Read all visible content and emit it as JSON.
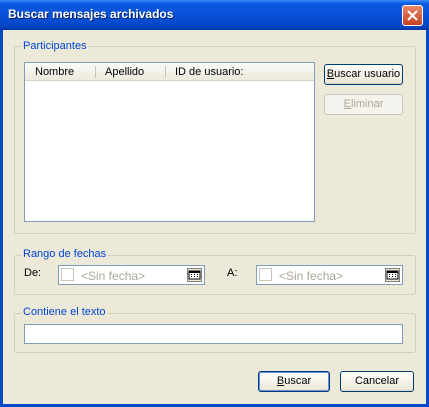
{
  "window": {
    "title": "Buscar mensajes archivados",
    "close_icon": "close-icon"
  },
  "participants": {
    "legend": "Participantes",
    "columns": [
      "Nombre",
      "Apellido",
      "ID de usuario:"
    ],
    "rows": [],
    "search_button": {
      "pre": "",
      "mnemonic": "B",
      "post": "uscar usuario"
    },
    "remove_button": {
      "pre": "",
      "mnemonic": "E",
      "post": "liminar"
    }
  },
  "date_range": {
    "legend": "Rango de fechas",
    "from_label": "De:",
    "to_label": "A:",
    "from_value": "<Sin fecha>",
    "to_value": "<Sin fecha>"
  },
  "text_filter": {
    "legend": "Contiene el texto",
    "value": ""
  },
  "footer": {
    "search_button": {
      "pre": "",
      "mnemonic": "B",
      "post": "uscar"
    },
    "cancel_label": "Cancelar"
  }
}
